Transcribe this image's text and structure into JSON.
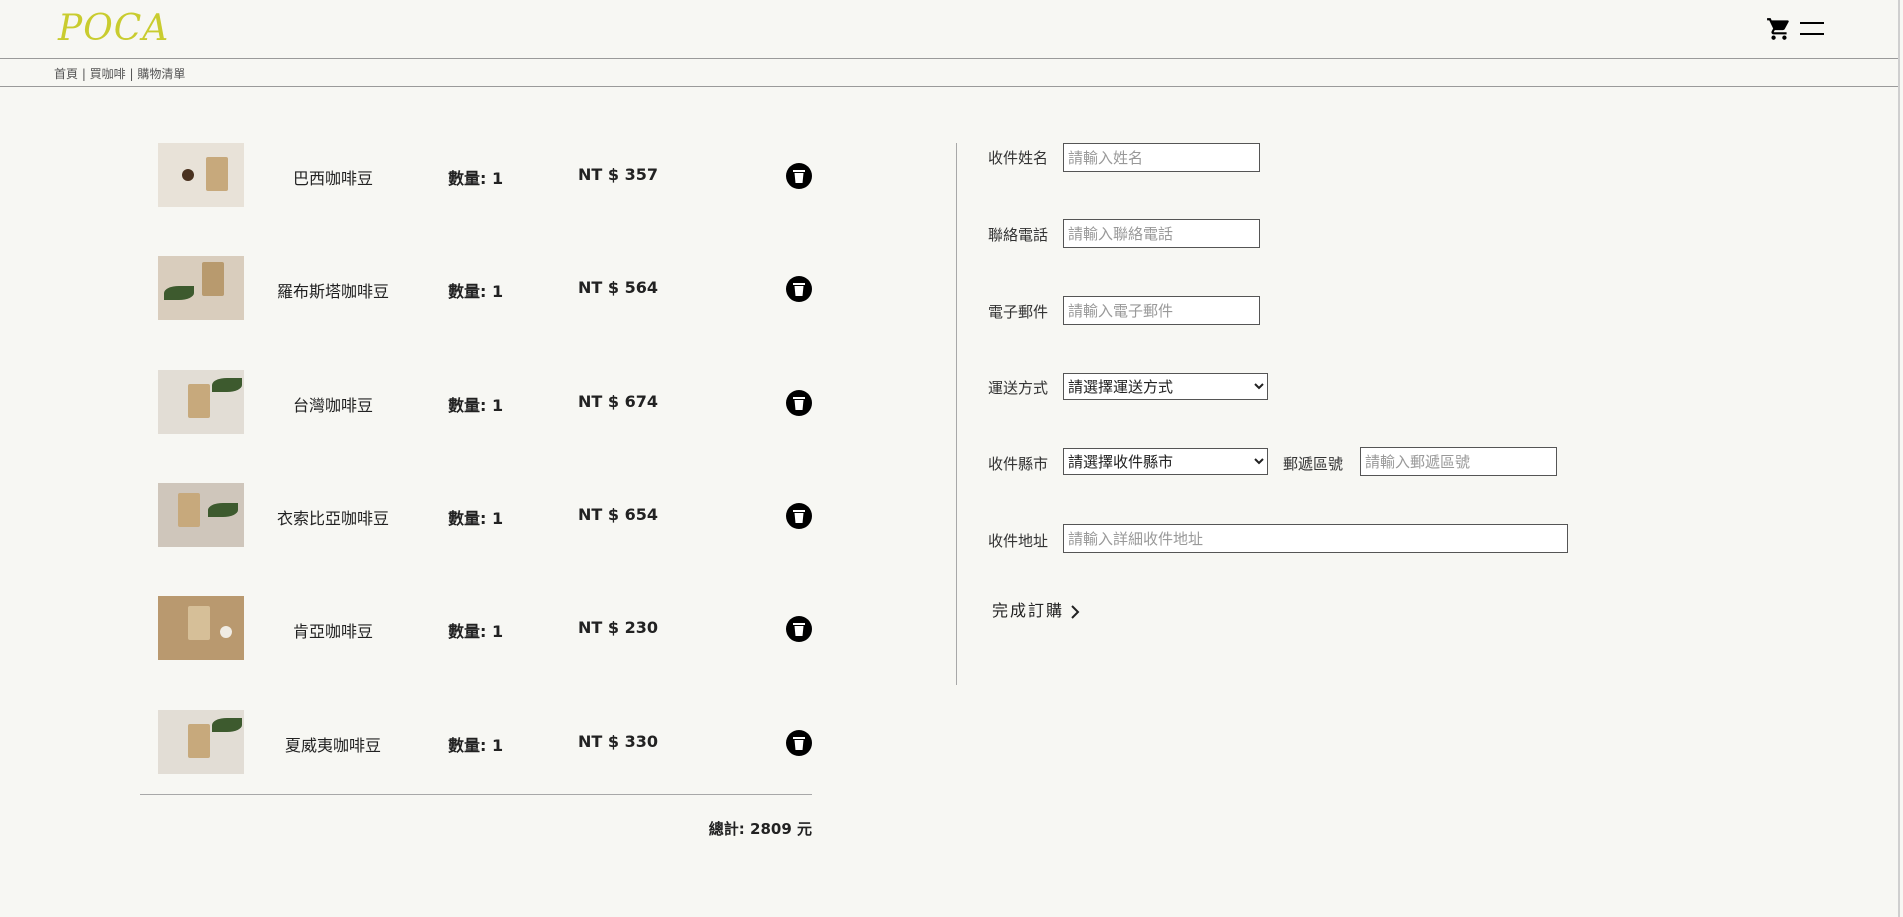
{
  "header": {
    "logo_text": "POCA",
    "cart_icon": "cart-icon",
    "menu_icon": "menu-icon"
  },
  "breadcrumb": "首頁 | 買咖啡 | 購物清單",
  "cart": {
    "items": [
      {
        "name": "巴西咖啡豆",
        "qty_label": "數量: 1",
        "price_label": "NT $ 357"
      },
      {
        "name": "羅布斯塔咖啡豆",
        "qty_label": "數量: 1",
        "price_label": "NT $ 564"
      },
      {
        "name": "台灣咖啡豆",
        "qty_label": "數量: 1",
        "price_label": "NT $ 674"
      },
      {
        "name": "衣索比亞咖啡豆",
        "qty_label": "數量: 1",
        "price_label": "NT $ 654"
      },
      {
        "name": "肯亞咖啡豆",
        "qty_label": "數量: 1",
        "price_label": "NT $ 230"
      },
      {
        "name": "夏威夷咖啡豆",
        "qty_label": "數量: 1",
        "price_label": "NT $ 330"
      }
    ],
    "total_label": "總計: 2809 元"
  },
  "form": {
    "name_label": "收件姓名",
    "name_placeholder": "請輸入姓名",
    "phone_label": "聯絡電話",
    "phone_placeholder": "請輸入聯絡電話",
    "email_label": "電子郵件",
    "email_placeholder": "請輸入電子郵件",
    "shipping_label": "運送方式",
    "shipping_selected": "請選擇運送方式",
    "city_label": "收件縣市",
    "city_selected": "請選擇收件縣市",
    "zip_label": "郵遞區號",
    "zip_placeholder": "請輸入郵遞區號",
    "address_label": "收件地址",
    "address_placeholder": "請輸入詳細收件地址",
    "submit_label": "完成訂購"
  },
  "colors": {
    "background": "#f7f7f3",
    "logo": "#c9cc2f",
    "delete_button": "#000000"
  }
}
